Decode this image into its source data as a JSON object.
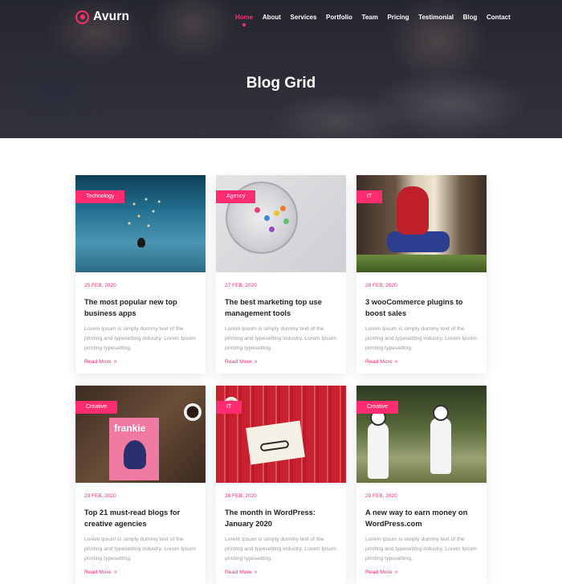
{
  "brand": {
    "name": "Avurn",
    "accent": "#ff2d6f"
  },
  "nav": {
    "items": [
      {
        "label": "Home",
        "active": true
      },
      {
        "label": "About"
      },
      {
        "label": "Services"
      },
      {
        "label": "Portfolio"
      },
      {
        "label": "Team"
      },
      {
        "label": "Pricing"
      },
      {
        "label": "Testimonial"
      },
      {
        "label": "Blog"
      },
      {
        "label": "Contact"
      }
    ]
  },
  "hero": {
    "title": "Blog Grid"
  },
  "posts": [
    {
      "tag": "Technology",
      "date": "25 FEB, 2020",
      "title": "The most popular new top business apps",
      "excerpt": "Lorem Ipsum is simply dummy text of the printing and typesetting industry. Lorem Ipsum printing typesetting.",
      "read_more": "Read More"
    },
    {
      "tag": "Agency",
      "date": "27 FEB, 2020",
      "title": "The best marketing top use management tools",
      "excerpt": "Lorem Ipsum is simply dummy text of the printing and typesetting industry. Lorem Ipsum printing typesetting.",
      "read_more": "Read More"
    },
    {
      "tag": "IT",
      "date": "28 FEB, 2020",
      "title": "3 wooCommerce plugins to boost sales",
      "excerpt": "Lorem Ipsum is simply dummy text of the printing and typesetting industry. Lorem Ipsum printing typesetting.",
      "read_more": "Read More"
    },
    {
      "tag": "Creative",
      "date": "29 FEB, 2020",
      "title": "Top 21 must-read blogs for creative agencies",
      "excerpt": "Lorem Ipsum is simply dummy text of the printing and typesetting industry. Lorem Ipsum printing typesetting.",
      "read_more": "Read More",
      "image_text": "frankie"
    },
    {
      "tag": "IT",
      "date": "28 FEB, 2020",
      "title": "The month in WordPress: January 2020",
      "excerpt": "Lorem Ipsum is simply dummy text of the printing and typesetting industry. Lorem Ipsum printing typesetting.",
      "read_more": "Read More"
    },
    {
      "tag": "Creative",
      "date": "29 FEB, 2020",
      "title": "A new way to earn money on WordPress.com",
      "excerpt": "Lorem Ipsum is simply dummy text of the printing and typesetting industry. Lorem Ipsum printing typesetting.",
      "read_more": "Read More"
    }
  ],
  "icons": {
    "logo": "circle-logo-icon",
    "read_more_arrow": "double-chevron-right-icon"
  }
}
